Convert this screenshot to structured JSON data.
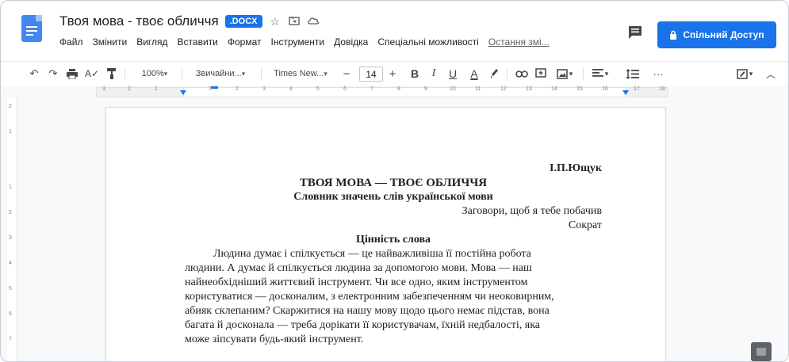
{
  "header": {
    "doc_title": "Твоя мова - твоє обличчя",
    "badge": ".DOCX",
    "icons": [
      "star-icon",
      "folder-move-icon",
      "cloud-status-icon"
    ]
  },
  "menu": {
    "items": [
      "Файл",
      "Змінити",
      "Вигляд",
      "Вставити",
      "Формат",
      "Інструменти",
      "Довідка",
      "Спеціальні можливості"
    ],
    "last_edit": "Остання змі..."
  },
  "share": {
    "label": "Спільний Доступ",
    "color": "#1a73e8"
  },
  "toolbar": {
    "zoom": "100%",
    "style": "Звичайни...",
    "font": "Times New...",
    "font_size": "14",
    "bold": "B",
    "italic": "I",
    "underline": "U",
    "text_color": "A",
    "more": "···"
  },
  "ruler": {
    "numbers": [
      "3",
      "2",
      "1",
      "1",
      "2",
      "3",
      "4",
      "5",
      "6",
      "7",
      "8",
      "9",
      "10",
      "11",
      "12",
      "13",
      "14",
      "15",
      "16",
      "17",
      "18"
    ]
  },
  "vruler": {
    "numbers": [
      "2",
      "1",
      "1",
      "2",
      "3",
      "4",
      "5",
      "6",
      "7"
    ]
  },
  "document": {
    "author": "І.П.Ющук",
    "title": "ТВОЯ МОВА — ТВОЄ ОБЛИЧЧЯ",
    "subtitle": "Словник значень слів української мови",
    "epigraph": "Заговори, щоб я тебе побачив",
    "epigraph_author": "Сократ",
    "section_heading": "Цінність слова",
    "paragraph_lines": [
      "Людина думає і спілкується — це найважливіша її постійна робота",
      "людини. А думає й спілкується людина за допомогою мови. Мова — наш",
      "найнеобхідніший життєвий інструмент. Чи все одно, яким інструментом",
      "користуватися — досконалим, з електронним забезпеченням чи неоковирним,",
      "абияк склепаним? Скаржитися на нашу мову щодо цього немає підстав, вона",
      "багата й досконала — треба дорікати її користувачам, їхній недбалості, яка",
      "може зіпсувати будь-який інструмент."
    ]
  }
}
